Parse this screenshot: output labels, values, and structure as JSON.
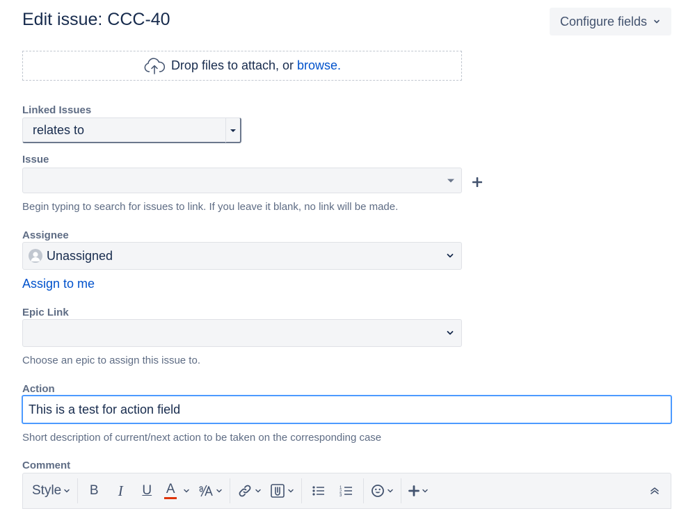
{
  "header": {
    "title": "Edit issue: CCC-40",
    "configure_label": "Configure fields"
  },
  "dropzone": {
    "text": "Drop files to attach, or",
    "browse": "browse."
  },
  "linked_issues": {
    "label": "Linked Issues",
    "selected": "relates to"
  },
  "issue": {
    "label": "Issue",
    "value": "",
    "help": "Begin typing to search for issues to link. If you leave it blank, no link will be made."
  },
  "assignee": {
    "label": "Assignee",
    "value": "Unassigned",
    "assign_to_me": "Assign to me"
  },
  "epic_link": {
    "label": "Epic Link",
    "value": "",
    "help": "Choose an epic to assign this issue to."
  },
  "action": {
    "label": "Action",
    "value": "This is a test for action field",
    "help": "Short description of current/next action to be taken on the corresponding case"
  },
  "comment": {
    "label": "Comment",
    "toolbar": {
      "style_label": "Style",
      "bold": "B",
      "italic": "I",
      "underline": "U",
      "color": "A"
    }
  },
  "colors": {
    "link": "#0052cc",
    "focus": "#4c9aff",
    "text_color_underline": "#de350b"
  }
}
